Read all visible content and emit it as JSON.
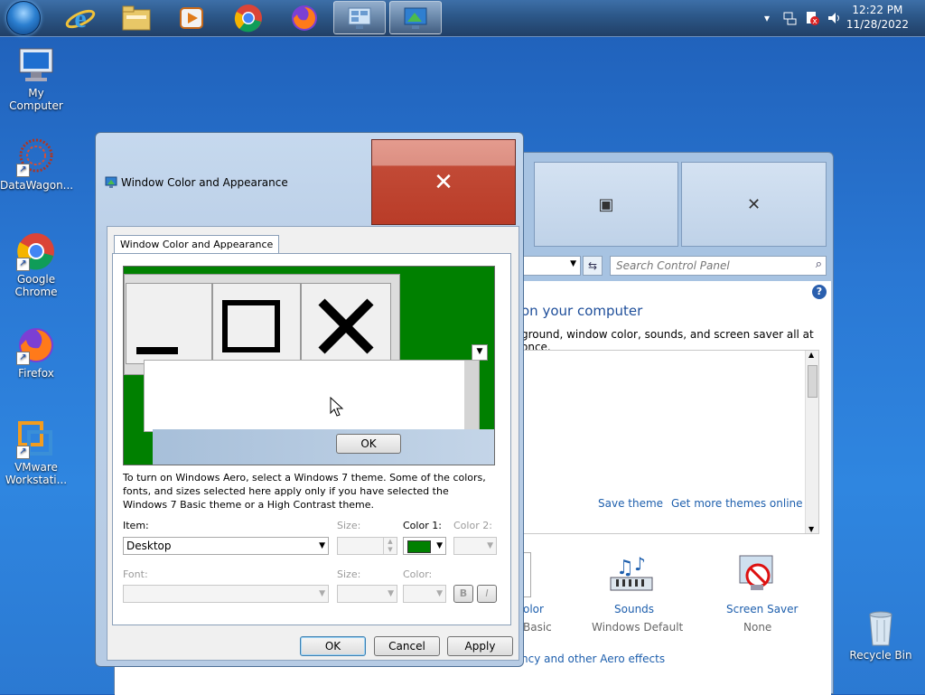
{
  "taskbar": {
    "clock_time": "12:22 PM",
    "clock_date": "11/28/2022"
  },
  "desktop_icons": [
    {
      "label": "My Computer"
    },
    {
      "label": "DataWagon..."
    },
    {
      "label": "Google Chrome"
    },
    {
      "label": "Firefox"
    },
    {
      "label": "VMware Workstati..."
    },
    {
      "label": "Recycle Bin"
    }
  ],
  "control_panel": {
    "search_placeholder": "Search Control Panel",
    "heading": "on your computer",
    "subtitle": "ground, window color, sounds, and screen saver all at once.",
    "save_theme": "Save theme",
    "get_more_themes": "Get more themes online",
    "color_label": "olor",
    "color_value": "Basic",
    "sounds_label": "Sounds",
    "sounds_value": "Windows Default",
    "screensaver_label": "Screen Saver",
    "screensaver_value": "None",
    "bottom_link": "ncy and other Aero effects"
  },
  "dialog": {
    "title": "Window Color and Appearance",
    "tab_label": "Window Color and Appearance",
    "preview_ok": "OK",
    "description": "To turn on Windows Aero, select a Windows 7 theme.  Some of the colors, fonts, and sizes selected here apply only if you have selected the Windows 7 Basic theme or a High Contrast theme.",
    "item_label": "Item:",
    "item_value": "Desktop",
    "size_label": "Size:",
    "color1_label": "Color 1:",
    "color1_value": "#008000",
    "color2_label": "Color 2:",
    "font_label": "Font:",
    "font_size_label": "Size:",
    "font_color_label": "Color:",
    "bold_label": "B",
    "italic_label": "I",
    "ok_button": "OK",
    "cancel_button": "Cancel",
    "apply_button": "Apply"
  }
}
